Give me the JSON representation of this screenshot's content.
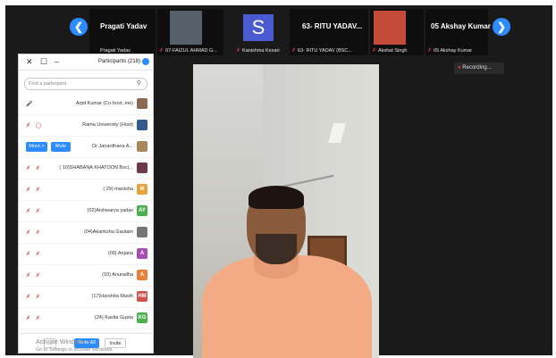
{
  "strip": {
    "thumbs": [
      {
        "big": "Pragati Yadav",
        "small": "Pragati Yadav"
      },
      {
        "big": "",
        "small": "07-FAIZUL AHMAD G..."
      },
      {
        "big": "",
        "small": "Kanishma Kesari"
      },
      {
        "big": "63- RITU YADAV...",
        "small": "63- RITU YADAV (BSC..."
      },
      {
        "big": "",
        "small": "Akshat Singh"
      },
      {
        "big": "05 Akshay Kumar",
        "small": "05 Akshay Kumar"
      }
    ],
    "avatar_letter": "S"
  },
  "recording": "Recording...",
  "panel": {
    "title": "Participants (218)",
    "search_placeholder": "Find a participant",
    "rows": [
      {
        "name": "Arpit Kumar (Co-host, me)",
        "avatar_letter": "",
        "avatar_color": "#8a6a50"
      },
      {
        "name": "Rama University (Host)",
        "avatar_letter": "",
        "avatar_color": "#335a8c"
      },
      {
        "name": "Dr Janardhana A...",
        "avatar_letter": "",
        "avatar_color": "#a8875a",
        "mute": "Mute",
        "more": "More >"
      },
      {
        "name": "( 10)SHABANA KHATOON Bsc(...",
        "avatar_letter": "",
        "avatar_color": "#6a3a4a"
      },
      {
        "name": "( 29) manisha",
        "avatar_letter": "M",
        "avatar_color": "#e8a33c"
      },
      {
        "name": "(02)Aishwarya yadav",
        "avatar_letter": "AY",
        "avatar_color": "#4caf50"
      },
      {
        "name": "(04)Akanksha Gautam",
        "avatar_letter": "",
        "avatar_color": "#777777"
      },
      {
        "name": "(09) Anjana",
        "avatar_letter": "A",
        "avatar_color": "#a64fb0"
      },
      {
        "name": "(10) Anuradha",
        "avatar_letter": "A",
        "avatar_color": "#e8803c"
      },
      {
        "name": "(17)Harshita Masih",
        "avatar_letter": "HM",
        "avatar_color": "#d0504a"
      },
      {
        "name": "(24) Kavita Gupta",
        "avatar_letter": "KG",
        "avatar_color": "#4caf50"
      }
    ],
    "invite": "Invite",
    "mute_all": "Mute All",
    "more": "..."
  },
  "watermark": {
    "line1": "Activate Windows",
    "line2": "Go to Settings to activate Windows."
  },
  "icons": {
    "left_arrow": "chevron-left-icon",
    "right_arrow": "chevron-right-icon"
  }
}
